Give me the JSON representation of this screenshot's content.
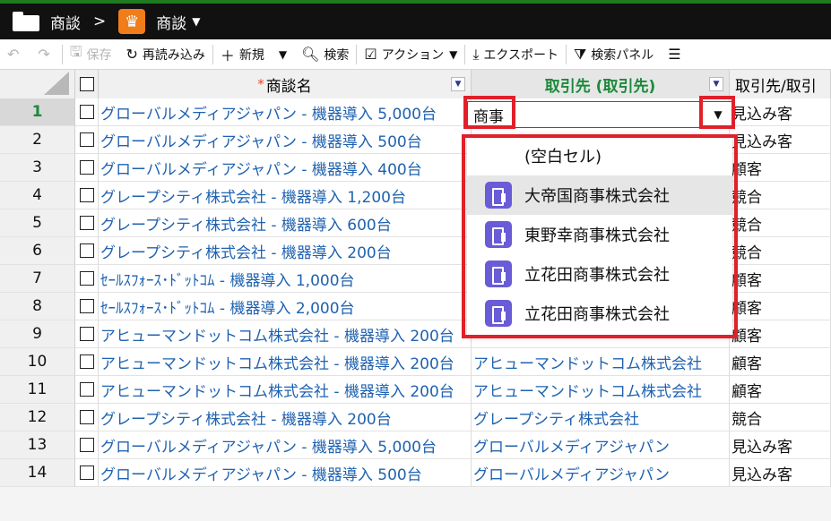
{
  "header": {
    "crumb1": "商談",
    "separator": ">",
    "crumb2": "商談",
    "caret": "▼"
  },
  "toolbar": {
    "undo_icon": "↶",
    "redo_icon": "↷",
    "save": "保存",
    "reload": "再読み込み",
    "new": "新規",
    "search": "検索",
    "action": "アクション",
    "export": "エクスポート",
    "search_panel": "検索パネル"
  },
  "columns": {
    "name": "商談名",
    "account": "取引先 (取引先)",
    "account_type": "取引先/取引"
  },
  "rows": [
    {
      "num": "1",
      "name": "グローバルメディアジャパン - 機器導入 5,000台",
      "account": "",
      "type": "見込み客"
    },
    {
      "num": "2",
      "name": "グローバルメディアジャパン - 機器導入 500台",
      "account": "",
      "type": "見込み客"
    },
    {
      "num": "3",
      "name": "グローバルメディアジャパン - 機器導入 400台",
      "account": "",
      "type": "顧客"
    },
    {
      "num": "4",
      "name": "グレープシティ株式会社 - 機器導入 1,200台",
      "account": "",
      "type": "競合"
    },
    {
      "num": "5",
      "name": "グレープシティ株式会社 - 機器導入 600台",
      "account": "",
      "type": "競合"
    },
    {
      "num": "6",
      "name": "グレープシティ株式会社 - 機器導入 200台",
      "account": "",
      "type": "競合"
    },
    {
      "num": "7",
      "name": "ｾｰﾙｽﾌｫｰｽ･ﾄﾞｯﾄｺﾑ - 機器導入 1,000台",
      "account": "",
      "type": "顧客"
    },
    {
      "num": "8",
      "name": "ｾｰﾙｽﾌｫｰｽ･ﾄﾞｯﾄｺﾑ - 機器導入 2,000台",
      "account": "",
      "type": "顧客"
    },
    {
      "num": "9",
      "name": "アヒューマンドットコム株式会社 - 機器導入 200台",
      "account": "",
      "type": "顧客"
    },
    {
      "num": "10",
      "name": "アヒューマンドットコム株式会社 - 機器導入 200台",
      "account": "アヒューマンドットコム株式会社",
      "type": "顧客"
    },
    {
      "num": "11",
      "name": "アヒューマンドットコム株式会社 - 機器導入 200台",
      "account": "アヒューマンドットコム株式会社",
      "type": "顧客"
    },
    {
      "num": "12",
      "name": "グレープシティ株式会社 - 機器導入 200台",
      "account": "グレープシティ株式会社",
      "type": "競合"
    },
    {
      "num": "13",
      "name": "グローバルメディアジャパン - 機器導入 5,000台",
      "account": "グローバルメディアジャパン",
      "type": "見込み客"
    },
    {
      "num": "14",
      "name": "グローバルメディアジャパン - 機器導入 500台",
      "account": "グローバルメディアジャパン",
      "type": "見込み客"
    }
  ],
  "editor": {
    "value": "商事",
    "dropdown_icon": "▼"
  },
  "dropdown": {
    "items": [
      "(空白セル)",
      "大帝国商事株式会社",
      "東野幸商事株式会社",
      "立花田商事株式会社",
      "立花田商事株式会社"
    ]
  },
  "colors": {
    "accent_green": "#1c8a3a",
    "link_blue": "#1f62b0",
    "highlight_red": "#e0202a",
    "building_icon": "#6a5bd6"
  }
}
